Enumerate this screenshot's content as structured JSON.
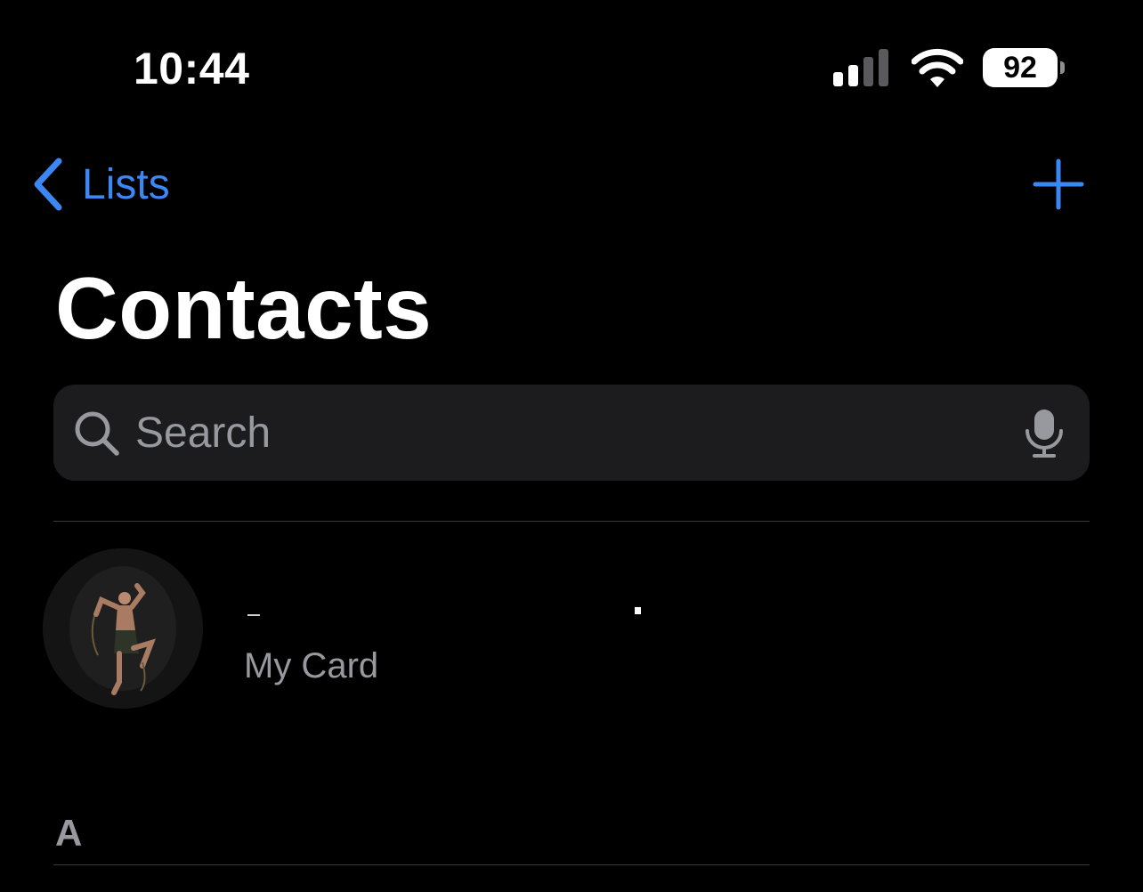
{
  "status_bar": {
    "time": "10:44",
    "battery_level": "92",
    "signal_bars_active": 2,
    "signal_bars_total": 4,
    "icons": [
      "cellular-signal-icon",
      "wifi-icon",
      "battery-icon"
    ]
  },
  "nav": {
    "back_label": "Lists",
    "back_icon": "chevron-left-icon",
    "add_icon": "plus-icon",
    "accent_color": "#3d87f5"
  },
  "page": {
    "title": "Contacts"
  },
  "search": {
    "placeholder": "Search",
    "value": "",
    "search_icon": "magnifying-glass-icon",
    "mic_icon": "microphone-icon"
  },
  "my_card": {
    "name": "",
    "subtitle": "My Card",
    "avatar": "contact-photo"
  },
  "sections": [
    {
      "letter": "A"
    }
  ],
  "colors": {
    "background": "#000000",
    "search_background": "#1c1c1e",
    "secondary_text": "#98989f",
    "separator": "#3a3a3c"
  }
}
